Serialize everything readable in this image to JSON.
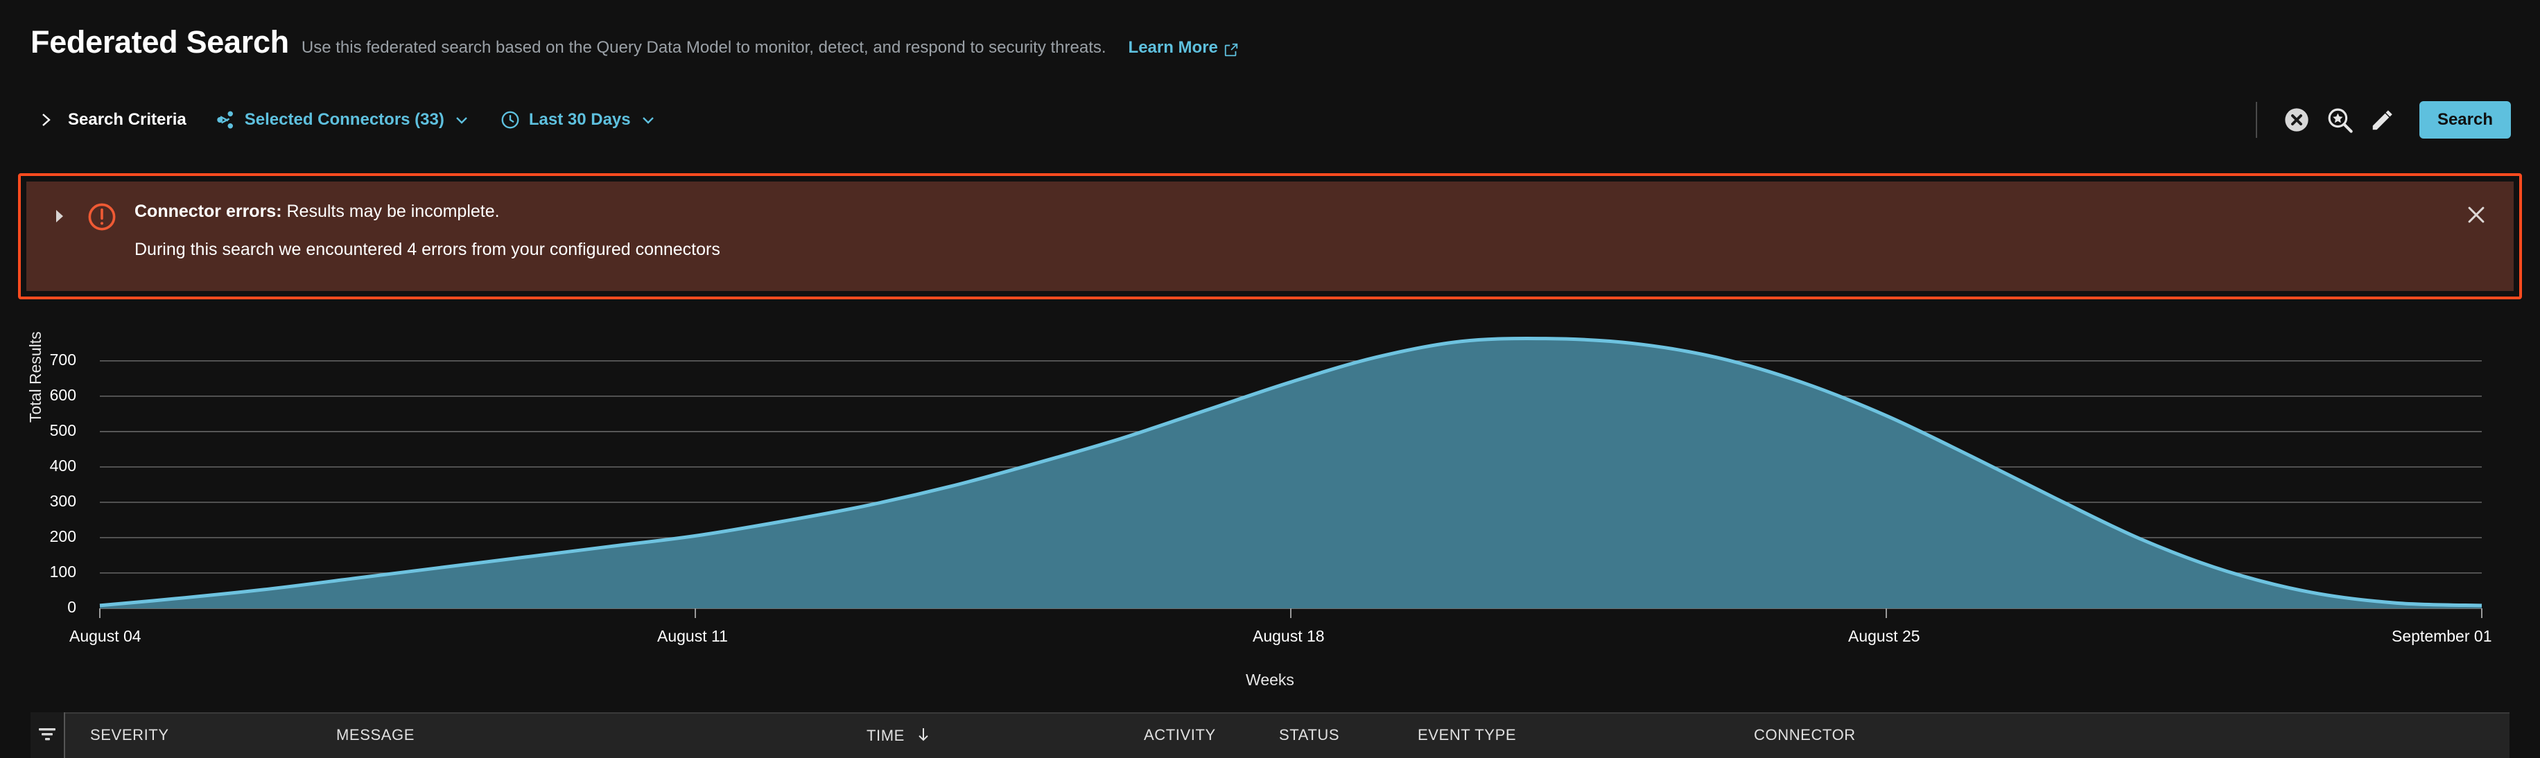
{
  "header": {
    "title": "Federated Search",
    "subtitle": "Use this federated search based on the Query Data Model to monitor, detect, and respond to security threats.",
    "learn_more": "Learn More",
    "learn_more_icon": "external-link-icon"
  },
  "criteria": {
    "expand_icon": "chevron-right-icon",
    "label": "Search Criteria",
    "connectors": {
      "icon": "share-nodes-icon",
      "label": "Selected Connectors (33)",
      "caret": "chevron-down-icon"
    },
    "time_range": {
      "icon": "clock-icon",
      "label": "Last 30 Days",
      "caret": "chevron-down-icon"
    },
    "actions": {
      "clear_icon": "close-circle-icon",
      "saved_search_icon": "search-star-icon",
      "edit_icon": "pencil-icon",
      "search_label": "Search"
    }
  },
  "error_banner": {
    "expand_icon": "caret-right-icon",
    "severity_icon": "exclamation-circle-icon",
    "title": "Connector errors:",
    "summary": "Results may be incomplete.",
    "detail": "During this search we encountered 4 errors from your configured connectors",
    "close_icon": "close-icon",
    "border_color": "#ff4b1f",
    "background_color": "#4e2a22"
  },
  "chart_data": {
    "type": "area",
    "title": "",
    "xlabel": "Weeks",
    "ylabel": "Total Results",
    "ylim": [
      0,
      700
    ],
    "yticks": [
      0,
      100,
      200,
      300,
      400,
      500,
      600,
      700
    ],
    "xticks": [
      "August 04",
      "August 11",
      "August 18",
      "August 25",
      "September 01"
    ],
    "grid": true,
    "legend": "none",
    "line_color": "#6ec3e0",
    "fill_color": "#40798d",
    "x": [
      "August 04",
      "August 05",
      "August 06",
      "August 07",
      "August 08",
      "August 09",
      "August 10",
      "August 11",
      "August 12",
      "August 13",
      "August 14",
      "August 15",
      "August 16",
      "August 17",
      "August 18",
      "August 19",
      "August 20",
      "August 21",
      "August 22",
      "August 23",
      "August 24",
      "August 25",
      "August 26",
      "August 27",
      "August 28",
      "August 29",
      "August 30",
      "August 31",
      "September 01"
    ],
    "values": [
      8,
      30,
      55,
      85,
      115,
      145,
      175,
      205,
      245,
      290,
      345,
      410,
      480,
      560,
      640,
      710,
      755,
      763,
      750,
      710,
      640,
      545,
      430,
      310,
      195,
      105,
      45,
      15,
      8
    ]
  },
  "results_table": {
    "filter_icon": "filter-icon",
    "columns": [
      {
        "label": "SEVERITY"
      },
      {
        "label": "MESSAGE"
      },
      {
        "label": "TIME",
        "sort": "desc",
        "sort_icon": "arrow-down-icon"
      },
      {
        "label": "ACTIVITY"
      },
      {
        "label": "STATUS"
      },
      {
        "label": "EVENT TYPE"
      },
      {
        "label": "CONNECTOR"
      }
    ]
  }
}
